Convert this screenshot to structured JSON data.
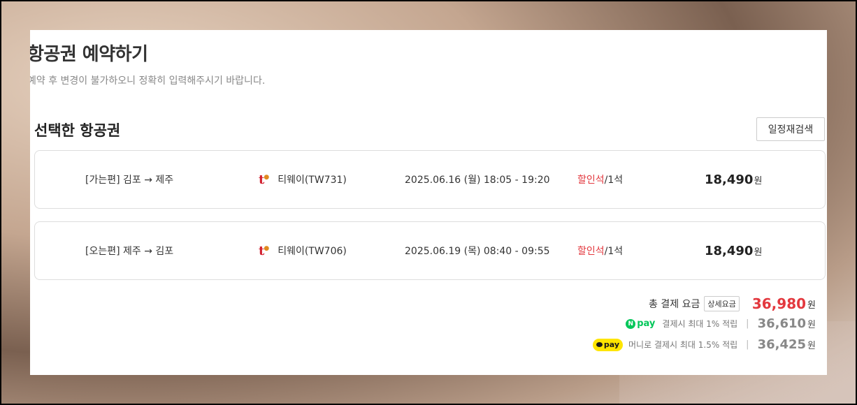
{
  "header": {
    "title": "항공권 예약하기",
    "subtitle": "예약 후 변경이 불가하오니 정확히 입력해주시기 바랍니다."
  },
  "selected": {
    "section_title": "선택한 항공권",
    "research_label": "일정재검색"
  },
  "flights": [
    {
      "route": "[가는편] 김포 → 제주",
      "airline": "티웨이(TW731)",
      "datetime": "2025.06.16 (월) 18:05 - 19:20",
      "seat_type": "할인석",
      "seat_count": "/1석",
      "price": "18,490",
      "currency": "원"
    },
    {
      "route": "[오는편] 제주 → 김포",
      "airline": "티웨이(TW706)",
      "datetime": "2025.06.19 (목) 08:40 - 09:55",
      "seat_type": "할인석",
      "seat_count": "/1석",
      "price": "18,490",
      "currency": "원"
    }
  ],
  "summary": {
    "total_label": "총 결제 요금",
    "detail_label": "상세요금",
    "total_amount": "36,980",
    "currency": "원",
    "npay_logo": "pay",
    "npay_desc": "결제시 최대 1% 적립",
    "npay_amount": "36,610",
    "kpay_logo": "pay",
    "kpay_desc": "머니로 결제시 최대 1.5% 적립",
    "kpay_amount": "36,425",
    "separator": "|"
  },
  "colors": {
    "accent_red": "#e3383e",
    "npay_green": "#03c75a",
    "kakao_yellow": "#fee500"
  }
}
